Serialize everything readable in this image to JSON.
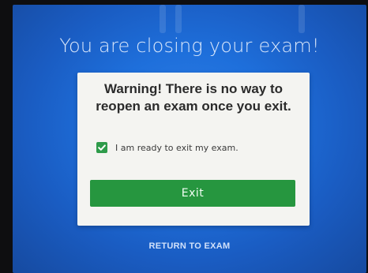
{
  "dialog": {
    "title": "You are closing your exam!",
    "warning_line1": "Warning! There is no way to",
    "warning_line2": "reopen an exam once you exit.",
    "checkbox_label": "I am ready to exit my exam.",
    "checkbox_checked": true,
    "exit_label": "Exit",
    "return_label": "RETURN TO EXAM"
  },
  "colors": {
    "background": "#1e6fdb",
    "card": "#f4f4f1",
    "accent_green": "#26963f",
    "checkbox_green": "#2e9b4a"
  },
  "icons": {
    "checkbox": "checkmark-icon"
  }
}
